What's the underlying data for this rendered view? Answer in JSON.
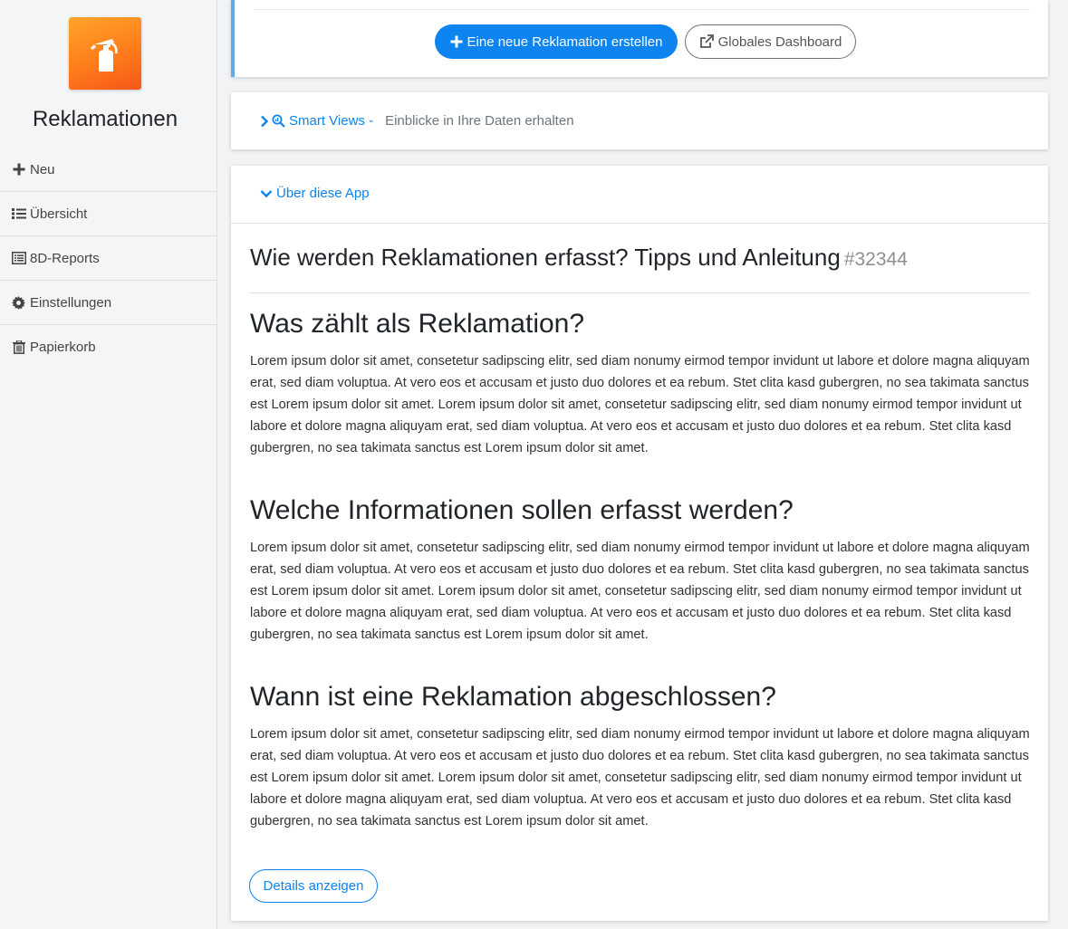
{
  "app": {
    "title": "Reklamationen",
    "logo_icon": "fire-extinguisher-icon",
    "logo_colors": [
      "#ffa42a",
      "#f4561a"
    ]
  },
  "sidebar": {
    "items": [
      {
        "label": "Neu",
        "icon": "plus-icon"
      },
      {
        "label": "Übersicht",
        "icon": "list-icon"
      },
      {
        "label": "8D-Reports",
        "icon": "list-box-icon"
      },
      {
        "label": "Einstellungen",
        "icon": "gear-icon"
      },
      {
        "label": "Papierkorb",
        "icon": "trash-icon"
      }
    ]
  },
  "actions": {
    "new_label": "Eine neue Reklamation erstellen",
    "dashboard_label": "Globales Dashboard"
  },
  "smart_views": {
    "label": "Smart Views -",
    "description": "Einblicke in Ihre Daten erhalten"
  },
  "about": {
    "toggle_label": "Über diese App",
    "title": "Wie werden Reklamationen erfasst? Tipps und Anleitung",
    "id": "#32344",
    "sections": [
      {
        "heading": "Was zählt als Reklamation?",
        "body": "Lorem ipsum dolor sit amet, consetetur sadipscing elitr, sed diam nonumy eirmod tempor invidunt ut labore et dolore magna aliquyam erat, sed diam voluptua. At vero eos et accusam et justo duo dolores et ea rebum. Stet clita kasd gubergren, no sea takimata sanctus est Lorem ipsum dolor sit amet. Lorem ipsum dolor sit amet, consetetur sadipscing elitr, sed diam nonumy eirmod tempor invidunt ut labore et dolore magna aliquyam erat, sed diam voluptua. At vero eos et accusam et justo duo dolores et ea rebum. Stet clita kasd gubergren, no sea takimata sanctus est Lorem ipsum dolor sit amet."
      },
      {
        "heading": "Welche Informationen sollen erfasst werden?",
        "body": "Lorem ipsum dolor sit amet, consetetur sadipscing elitr, sed diam nonumy eirmod tempor invidunt ut labore et dolore magna aliquyam erat, sed diam voluptua. At vero eos et accusam et justo duo dolores et ea rebum. Stet clita kasd gubergren, no sea takimata sanctus est Lorem ipsum dolor sit amet. Lorem ipsum dolor sit amet, consetetur sadipscing elitr, sed diam nonumy eirmod tempor invidunt ut labore et dolore magna aliquyam erat, sed diam voluptua. At vero eos et accusam et justo duo dolores et ea rebum. Stet clita kasd gubergren, no sea takimata sanctus est Lorem ipsum dolor sit amet."
      },
      {
        "heading": "Wann ist eine Reklamation abgeschlossen?",
        "body": "Lorem ipsum dolor sit amet, consetetur sadipscing elitr, sed diam nonumy eirmod tempor invidunt ut labore et dolore magna aliquyam erat, sed diam voluptua. At vero eos et accusam et justo duo dolores et ea rebum. Stet clita kasd gubergren, no sea takimata sanctus est Lorem ipsum dolor sit amet. Lorem ipsum dolor sit amet, consetetur sadipscing elitr, sed diam nonumy eirmod tempor invidunt ut labore et dolore magna aliquyam erat, sed diam voluptua. At vero eos et accusam et justo duo dolores et ea rebum. Stet clita kasd gubergren, no sea takimata sanctus est Lorem ipsum dolor sit amet."
      }
    ],
    "details_label": "Details anzeigen"
  },
  "colors": {
    "primary": "#0d84f0",
    "accent_border": "#62a8e5"
  }
}
